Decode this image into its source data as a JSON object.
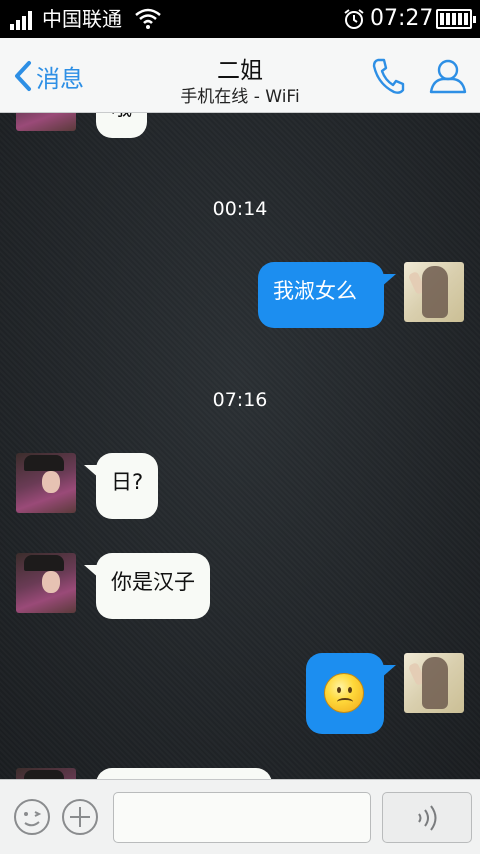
{
  "status_bar": {
    "carrier": "中国联通",
    "time": "07:27",
    "icons": [
      "signal-icon",
      "wifi-icon",
      "alarm-icon",
      "battery-icon"
    ]
  },
  "nav": {
    "back_label": "消息",
    "title": "二姐",
    "subtitle": "手机在线 - WiFi",
    "icons": [
      "chevron-left-icon",
      "phone-icon",
      "profile-icon"
    ],
    "accent_color": "#2d8fe5"
  },
  "chat": {
    "timestamps": [
      "00:14",
      "07:16"
    ],
    "messages": [
      {
        "sender": "sister",
        "text": "哦"
      },
      {
        "sender": "me",
        "text": "我淑女么"
      },
      {
        "sender": "sister",
        "text": "日?"
      },
      {
        "sender": "sister",
        "text": "你是汉子"
      },
      {
        "sender": "me",
        "emoji": "sad-face-emoji"
      }
    ],
    "outgoing_bubble_color": "#1c8ef0",
    "incoming_bubble_color": "#f8faf6"
  },
  "input_bar": {
    "message_placeholder": "",
    "icons": [
      "emoji-icon",
      "plus-icon",
      "voice-icon"
    ]
  }
}
